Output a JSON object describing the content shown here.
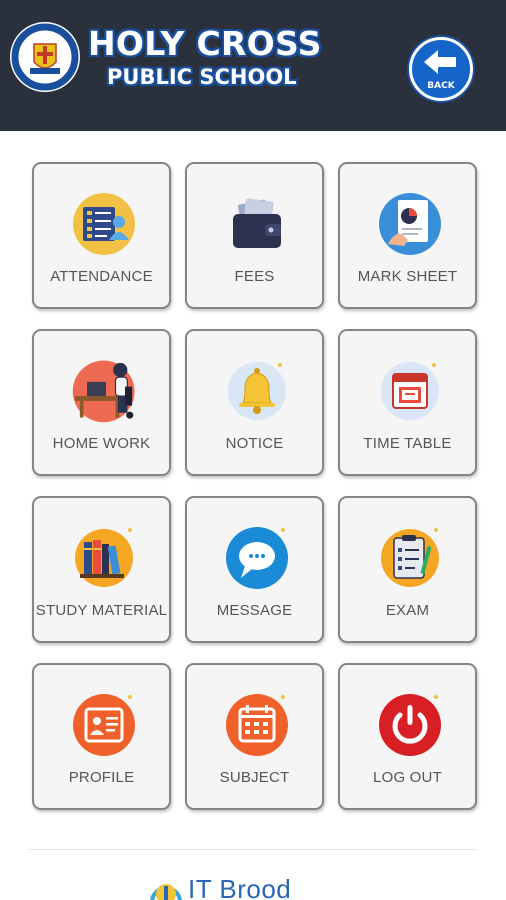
{
  "header": {
    "school_name": "HOLY CROSS",
    "school_sub": "PUBLIC SCHOOL",
    "back_label": "BACK",
    "bg_color": "#2b313c",
    "accent": "#1565c8"
  },
  "menu": [
    {
      "label": "ATTENDANCE",
      "icon": "attendance-icon"
    },
    {
      "label": "FEES",
      "icon": "wallet-icon"
    },
    {
      "label": "MARK SHEET",
      "icon": "marksheet-icon"
    },
    {
      "label": "HOME WORK",
      "icon": "homework-icon"
    },
    {
      "label": "NOTICE",
      "icon": "bell-icon"
    },
    {
      "label": "TIME TABLE",
      "icon": "calendar-icon"
    },
    {
      "label": "STUDY MATERIAL",
      "icon": "books-icon"
    },
    {
      "label": "MESSAGE",
      "icon": "message-icon"
    },
    {
      "label": "EXAM",
      "icon": "clipboard-icon"
    },
    {
      "label": "PROFILE",
      "icon": "profile-icon"
    },
    {
      "label": "SUBJECT",
      "icon": "subject-icon"
    },
    {
      "label": "LOG OUT",
      "icon": "power-icon"
    }
  ],
  "footer": {
    "brand": "IT Brood"
  }
}
